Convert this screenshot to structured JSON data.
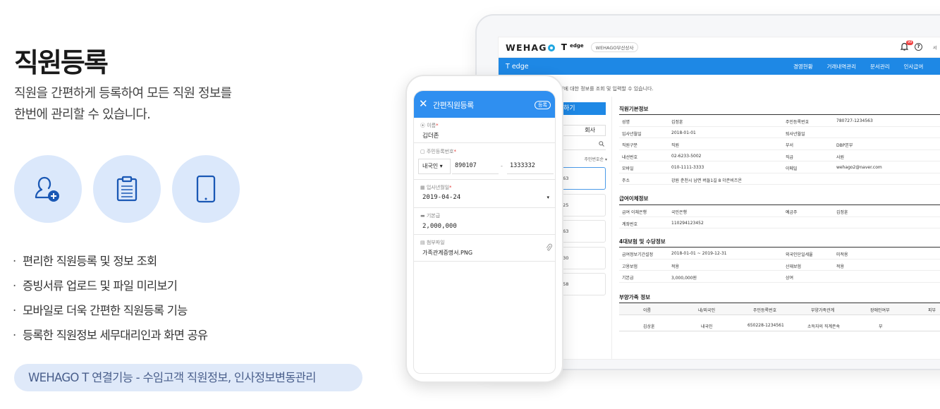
{
  "left": {
    "title": "직원등록",
    "desc_line1": "직원을 간편하게 등록하여 모든 직원 정보를",
    "desc_line2": "한번에 관리할 수 있습니다.",
    "icons": [
      "add-user-icon",
      "clipboard-icon",
      "mobile-icon"
    ],
    "bullets": [
      "편리한 직원등록 및 정보 조회",
      "증빙서류 업로드 및 파일 미리보기",
      "모바일로 더욱 간편한 직원등록 기능",
      "등록한 직원정보 세무대리인과 화면 공유"
    ],
    "bullet_mark": "·",
    "pill": "WEHAGO T 연결기능 - 수임고객 직원정보, 인사정보변동관리"
  },
  "laptop": {
    "logo": "WEHAG",
    "logo_suffix": "T",
    "tedge_small": "edge",
    "company": "WEHAGO부산상사",
    "badge": "99",
    "trunc": "서",
    "bar_title": "T edge",
    "nav": [
      "경영현황",
      "거래내역관리",
      "문서관리",
      "인사급여"
    ],
    "intro": "원에 대한 정보를 조회 및 입력할 수 있습니다.",
    "list_button": "하기",
    "tab": "회사",
    "sort": "주민번호순",
    "cards": [
      "563",
      "325",
      "563",
      "230",
      "558"
    ],
    "basic_title": "직원기본정보",
    "basic_rows": [
      [
        "성명",
        "김정훈",
        "주민등록번호",
        "780727-1234563"
      ],
      [
        "입사년월일",
        "2018-01-01",
        "퇴사년월일",
        ""
      ],
      [
        "직원구분",
        "직원",
        "부서",
        "DBP본부"
      ],
      [
        "내선번호",
        "02-6233-5002",
        "직급",
        "사원"
      ],
      [
        "모바일",
        "010-1111-3333",
        "이메일",
        "wehago2@naver.com"
      ],
      [
        "주소",
        "강원 춘천시 남면 버들1길 8 더존비즈온",
        "",
        ""
      ]
    ],
    "pay_title": "급여이체정보",
    "pay_rows": [
      [
        "급여 이체은행",
        "국민은행",
        "예금주",
        "김정훈"
      ],
      [
        "계좌번호",
        "110294123452",
        "",
        ""
      ]
    ],
    "ins_title": "4대보험 및 수당정보",
    "ins_rows": [
      [
        "급여정보기간설정",
        "2018-01-01 ~ 2019-12-31",
        "외국인단일세율",
        "미적용"
      ],
      [
        "고용보험",
        "적용",
        "산재보험",
        "적용"
      ],
      [
        "기본급",
        "3,000,000원",
        "상여",
        ""
      ]
    ],
    "dep_title": "부양가족 정보",
    "dep_headers": [
      "이름",
      "내/외국인",
      "주민등록번호",
      "부양가족관계",
      "장애인여부",
      "피부"
    ],
    "dep_row": [
      "김상훈",
      "내국인",
      "650228-1234561",
      "소득자의 직계존속",
      "부",
      ""
    ]
  },
  "phone": {
    "title": "간편직원등록",
    "close": "✕",
    "register": "등록",
    "name_label": "이름",
    "name_value": "김더존",
    "rrn_label": "주민등록번호",
    "nationality": "내국인",
    "rrn_front": "890107",
    "rrn_dash": "-",
    "rrn_back": "1333332",
    "join_label": "입사년월일",
    "join_value": "2019-04-24",
    "salary_label": "기본급",
    "salary_value": "2,000,000",
    "file_label": "첨부파일",
    "file_value": "가족관계증명서.PNG"
  }
}
